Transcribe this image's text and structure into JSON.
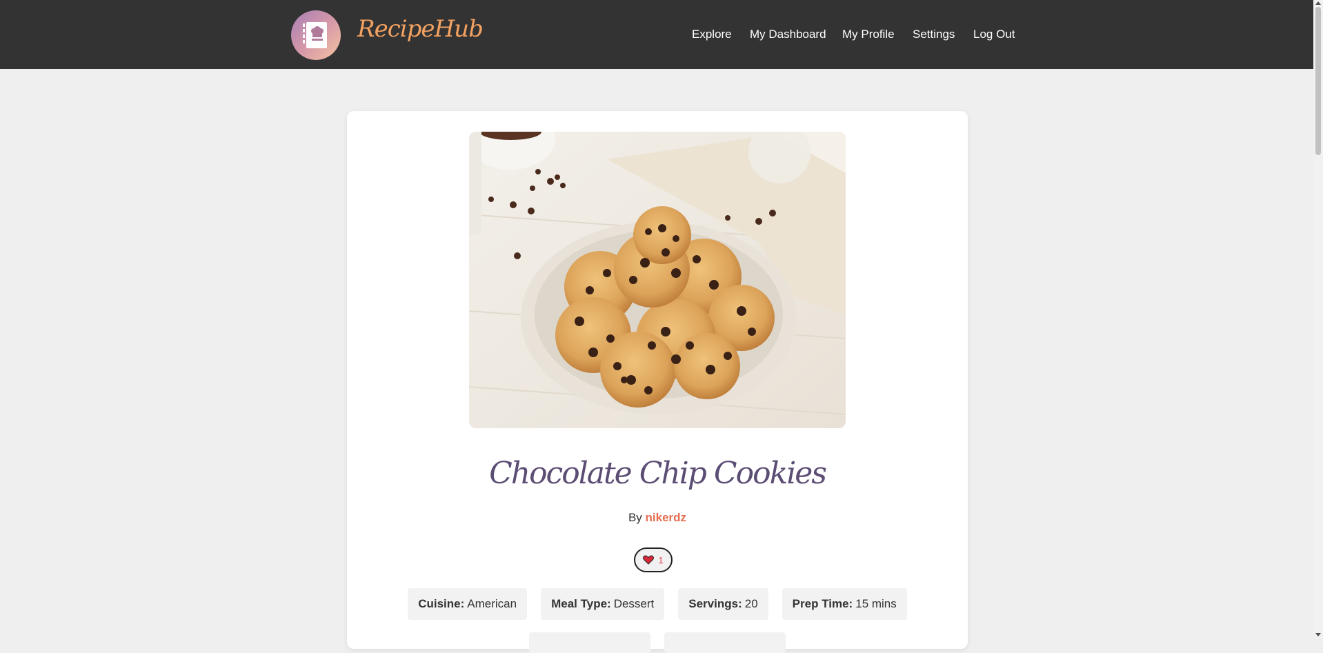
{
  "header": {
    "brand": "RecipeHub",
    "nav": [
      "Explore",
      "My Dashboard",
      "My Profile",
      "Settings",
      "Log Out"
    ]
  },
  "recipe": {
    "title": "Chocolate Chip Cookies",
    "by_label": "By",
    "author": "nikerdz",
    "likes": "1",
    "details": [
      {
        "label": "Cuisine:",
        "value": "American"
      },
      {
        "label": "Meal Type:",
        "value": "Dessert"
      },
      {
        "label": "Servings:",
        "value": "20"
      },
      {
        "label": "Prep Time:",
        "value": "15 mins"
      }
    ]
  },
  "colors": {
    "header_bg": "#333333",
    "brand": "#f4a261",
    "title": "#5b4d73",
    "author": "#e76f51",
    "like": "#e63946"
  }
}
